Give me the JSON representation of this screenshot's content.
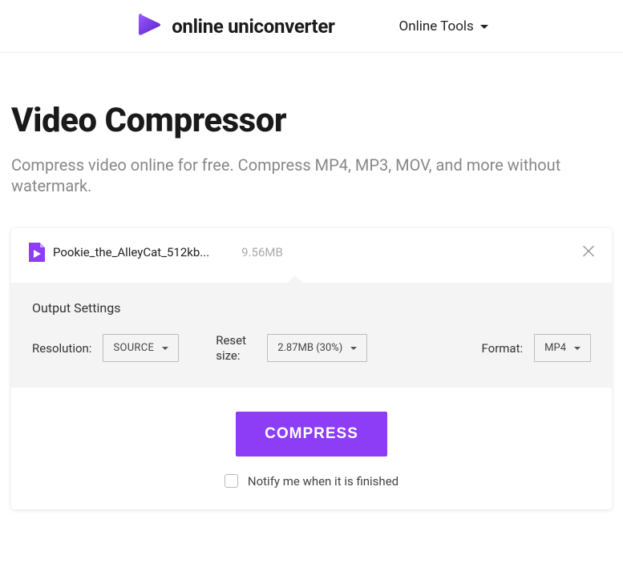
{
  "header": {
    "brand": "online uniconverter",
    "nav_tools": "Online Tools"
  },
  "page": {
    "title": "Video Compressor",
    "subtitle": "Compress video online for free. Compress MP4, MP3, MOV, and more without watermark."
  },
  "file": {
    "name": "Pookie_the_AlleyCat_512kb...",
    "size": "9.56MB"
  },
  "settings": {
    "heading": "Output Settings",
    "resolution_label": "Resolution:",
    "resolution_value": "SOURCE",
    "reset_label": "Reset size:",
    "reset_value": "2.87MB (30%)",
    "format_label": "Format:",
    "format_value": "MP4"
  },
  "actions": {
    "compress": "COMPRESS",
    "notify": "Notify me when it is finished"
  },
  "colors": {
    "accent": "#8c3df5"
  }
}
